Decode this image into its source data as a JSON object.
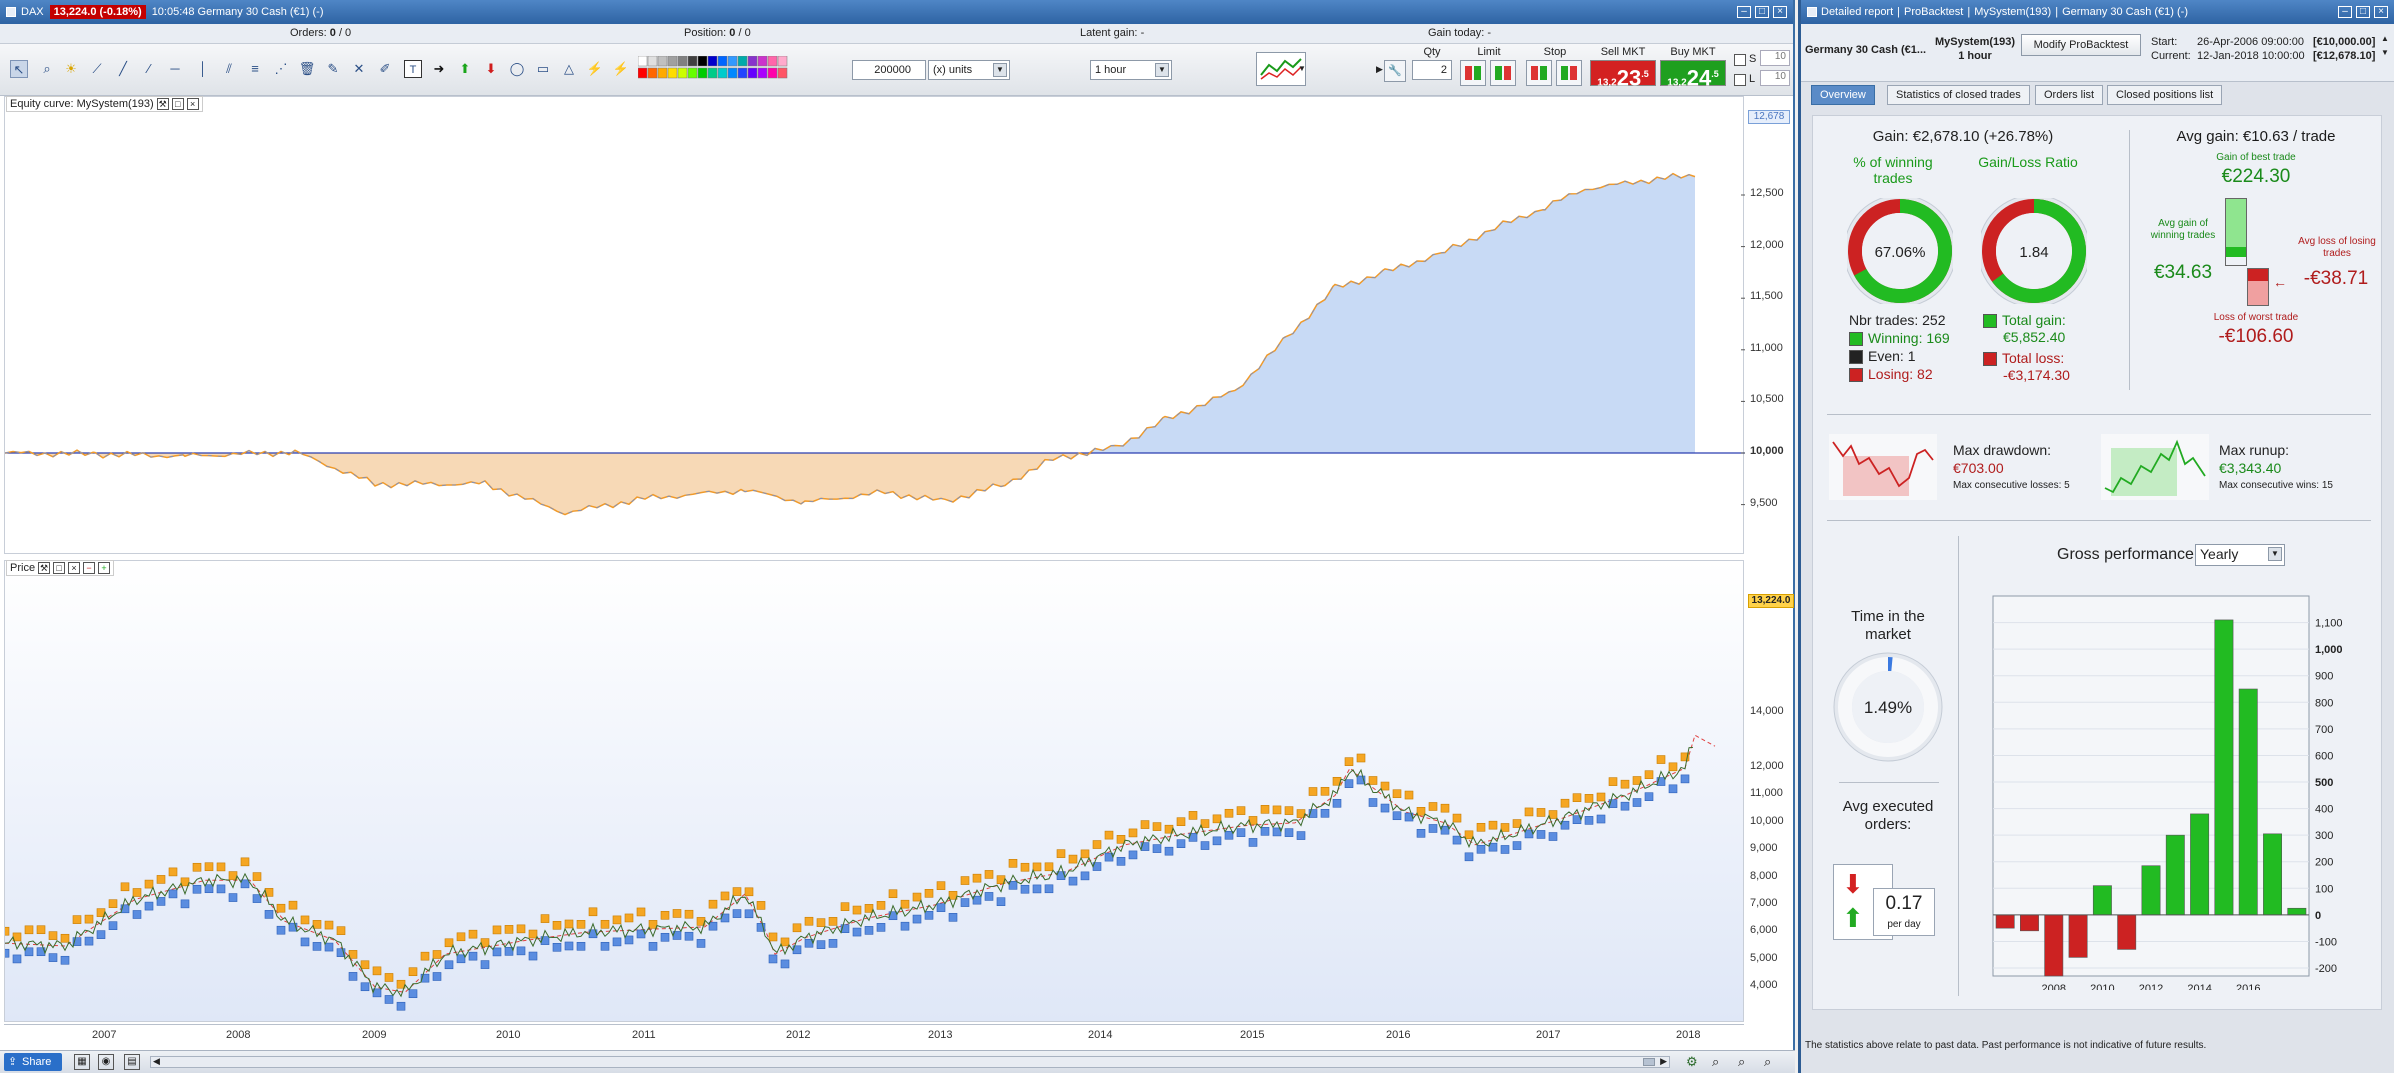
{
  "left_window": {
    "instrument": "DAX",
    "price_badge": "13,224.0 (-0.18%)",
    "title": "10:05:48 Germany 30 Cash (€1) (-)",
    "orders_label": "Orders:",
    "orders_value": "0",
    "orders_value2": "/ 0",
    "position_label": "Position:",
    "position_value": "0",
    "position_value2": "/ 0",
    "latent_gain_label": "Latent gain:",
    "latent_gain_value": "-",
    "gain_today_label": "Gain today:",
    "gain_today_value": "-"
  },
  "toolbar": {
    "units_value": "200000",
    "units_type": "(x) units",
    "timeframe": "1 hour",
    "qty_label": "Qty",
    "qty_value": "2",
    "limit_label": "Limit",
    "stop_label": "Stop",
    "sell_label": "Sell MKT",
    "sell_small": "13,2",
    "sell_big": "23",
    "sell_sup": ".5",
    "buy_label": "Buy MKT",
    "buy_small": "13,2",
    "buy_big": "24",
    "buy_sup": ".5",
    "s_label": "S",
    "l_label": "L",
    "s_value": "10",
    "l_value": "10"
  },
  "equity_pane": {
    "title": "Equity curve: MySystem(193)",
    "y_ticks": [
      "12,500",
      "12,000",
      "11,500",
      "11,000",
      "10,500",
      "10,000",
      "9,500"
    ],
    "current_tag": "12,678"
  },
  "price_pane": {
    "title": "Price",
    "y_ticks": [
      "14,000",
      "12,000",
      "11,000",
      "10,000",
      "9,000",
      "8,000",
      "7,000",
      "6,000",
      "5,000",
      "4,000"
    ],
    "current_tag": "13,224.0",
    "years": [
      "2007",
      "2008",
      "2009",
      "2010",
      "2011",
      "2012",
      "2013",
      "2014",
      "2015",
      "2016",
      "2017",
      "2018"
    ]
  },
  "bottom_bar": {
    "share_label": "Share"
  },
  "right_window": {
    "title_items": [
      "Detailed report",
      "ProBacktest",
      "MySystem(193)",
      "Germany 30 Cash (€1) (-)"
    ],
    "instrument": "Germany 30 Cash (€1...",
    "system_name": "MySystem(193)",
    "system_tf": "1 hour",
    "modify_button": "Modify ProBacktest",
    "start_label": "Start:",
    "start_value": "26-Apr-2006 09:00:00",
    "start_amount": "[€10,000.00]",
    "current_label": "Current:",
    "current_value": "12-Jan-2018 10:00:00",
    "current_amount": "[€12,678.10]",
    "tabs": [
      "Overview",
      "Statistics of closed trades",
      "Orders list",
      "Closed positions list"
    ],
    "footer": "The statistics above relate to past data. Past performance is not indicative of future results."
  },
  "overview": {
    "gain_text": "Gain: €2,678.10 (+26.78%)",
    "winning_title": "% of winning trades",
    "winning_pct": "67.06%",
    "winning_fraction": 0.6706,
    "ratio_title": "Gain/Loss Ratio",
    "ratio_value": "1.84",
    "ratio_fraction": 0.648,
    "nbr_trades": "Nbr trades: 252",
    "winning": "Winning: 169",
    "even": "Even: 1",
    "losing": "Losing: 82",
    "total_gain_label": "Total gain:",
    "total_gain_value": "€5,852.40",
    "total_loss_label": "Total loss:",
    "total_loss_value": "-€3,174.30",
    "avg_gain_title": "Avg gain: €10.63 / trade",
    "best_trade_label": "Gain of best trade",
    "best_trade_value": "€224.30",
    "avg_win_label": "Avg gain of winning trades",
    "avg_win_value": "€34.63",
    "avg_loss_label": "Avg loss of losing trades",
    "avg_loss_value": "-€38.71",
    "worst_trade_label": "Loss of worst trade",
    "worst_trade_value": "-€106.60",
    "max_drawdown_label": "Max drawdown:",
    "max_drawdown_value": "€703.00",
    "max_consec_losses": "Max consecutive losses: 5",
    "max_runup_label": "Max runup:",
    "max_runup_value": "€3,343.40",
    "max_consec_wins": "Max consecutive wins: 15",
    "time_in_market_label": "Time in the market",
    "time_in_market_value": "1.49%",
    "time_in_market_fraction": 0.0149,
    "avg_orders_label": "Avg executed orders:",
    "avg_orders_value": "0.17",
    "avg_orders_unit": "per day",
    "gross_perf_label": "Gross performance",
    "gross_perf_period": "Yearly"
  },
  "chart_data": {
    "type": "bar",
    "title": "Gross performance",
    "categories": [
      "2006",
      "2007",
      "2008",
      "2009",
      "2010",
      "2011",
      "2012",
      "2013",
      "2014",
      "2015",
      "2016",
      "2017",
      "2018"
    ],
    "values": [
      -50,
      -60,
      -230,
      -160,
      110,
      -130,
      185,
      300,
      380,
      1110,
      850,
      305,
      25
    ],
    "ylim": [
      -230,
      1200
    ],
    "y_ticks": [
      "1,100",
      "1,000",
      "900",
      "800",
      "700",
      "600",
      "500",
      "400",
      "300",
      "200",
      "100",
      "0",
      "-100",
      "-200"
    ],
    "y_tick_values": [
      1100,
      1000,
      900,
      800,
      700,
      600,
      500,
      400,
      300,
      200,
      100,
      0,
      -100,
      -200
    ],
    "x_tick_labels": [
      "2008",
      "2010",
      "2012",
      "2014",
      "2016"
    ],
    "colors": {
      "positive": "#22bb22",
      "negative": "#cc2222"
    }
  }
}
